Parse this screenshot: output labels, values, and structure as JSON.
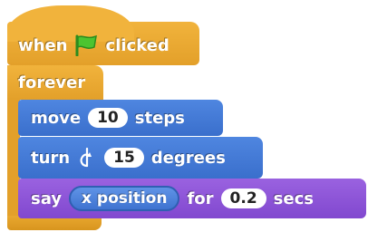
{
  "script": {
    "hat": {
      "when_label": "when",
      "clicked_label": "clicked",
      "flag_icon": "green-flag-icon",
      "color": "#e6a22c"
    },
    "forever": {
      "label": "forever",
      "color": "#e6a22c"
    },
    "move": {
      "label": "move",
      "value": "10",
      "unit": "steps",
      "color": "#4a7ee0"
    },
    "turn": {
      "label": "turn",
      "icon": "rotate-clockwise-icon",
      "value": "15",
      "unit": "degrees",
      "color": "#4a7ee0"
    },
    "say": {
      "label": "say",
      "reporter": "x position",
      "for_label": "for",
      "value": "0.2",
      "unit": "secs",
      "color": "#8f55d8"
    }
  }
}
